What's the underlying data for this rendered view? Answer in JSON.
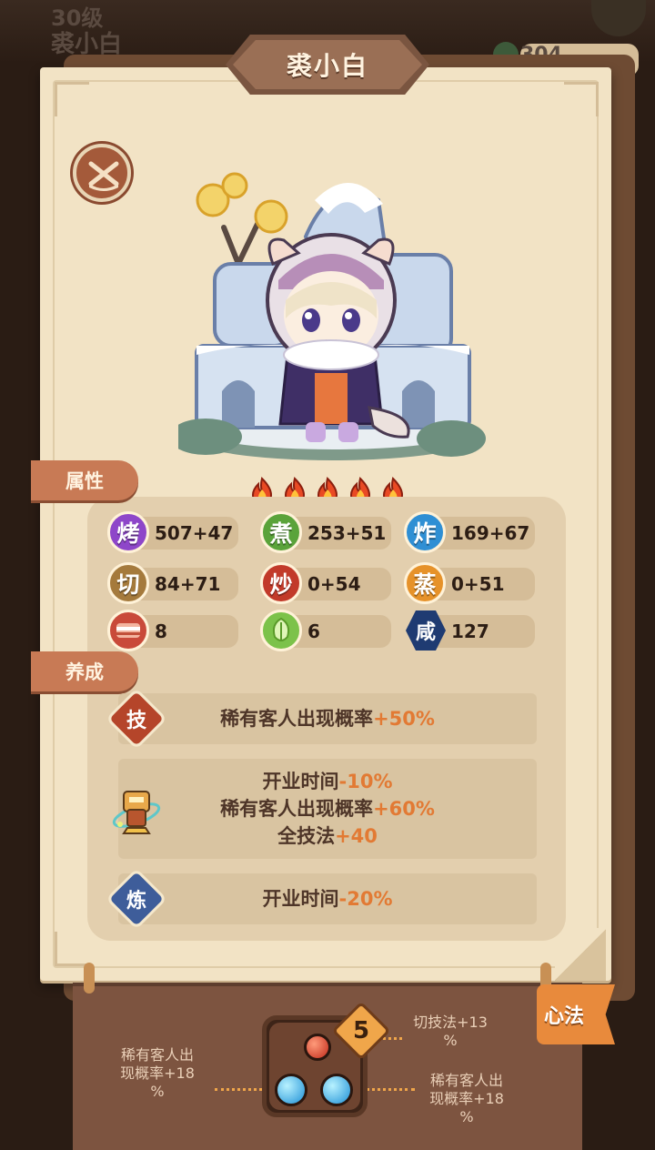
{
  "background": {
    "level_text": "30级",
    "name_text": "裘小白",
    "stat_text": "304"
  },
  "character": {
    "name": "裘小白",
    "rarity_flames": 5
  },
  "tabs": {
    "attributes": "属性",
    "cultivation": "养成"
  },
  "stats": [
    {
      "icon": "烤",
      "value": "507+47",
      "color": "#8e46c9"
    },
    {
      "icon": "煮",
      "value": "253+51",
      "color": "#5aa33a"
    },
    {
      "icon": "炸",
      "value": "169+67",
      "color": "#2f8fd4"
    },
    {
      "icon": "切",
      "value": "84+71",
      "color": "#a57a3c"
    },
    {
      "icon": "炒",
      "value": "0+54",
      "color": "#c23a2a"
    },
    {
      "icon": "蒸",
      "value": "0+51",
      "color": "#e6922a"
    }
  ],
  "materials": [
    {
      "name": "meat",
      "value": "8"
    },
    {
      "name": "vegetable",
      "value": "6"
    },
    {
      "name": "salty",
      "icon": "咸",
      "value": "127"
    }
  ],
  "cultivation": {
    "skill": {
      "icon": "技",
      "lines": [
        {
          "text": "稀有客人出现概率",
          "bonus": "+50%"
        }
      ]
    },
    "equipment": {
      "lines": [
        {
          "text": "开业时间",
          "bonus": "-10%"
        },
        {
          "text": "稀有客人出现概率",
          "bonus": "+60%"
        },
        {
          "text": "全技法",
          "bonus": "+40"
        }
      ]
    },
    "refine": {
      "icon": "炼",
      "lines": [
        {
          "text": "开业时间",
          "bonus": "-20%"
        }
      ]
    }
  },
  "heart_method": {
    "button_label": "心法",
    "level": "5",
    "bonus_top_right": [
      "切技法+13",
      "%"
    ],
    "bonus_left": [
      "稀有客人出",
      "现概率+18",
      "%"
    ],
    "bonus_right": [
      "稀有客人出",
      "现概率+18",
      "%"
    ]
  }
}
